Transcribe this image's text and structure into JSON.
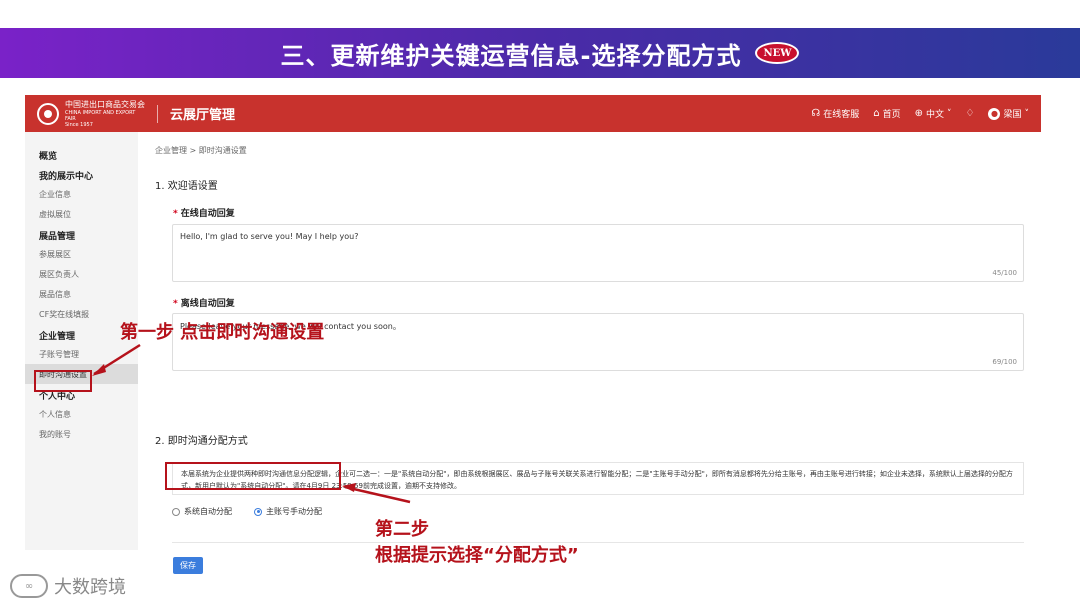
{
  "slide": {
    "title": "三、更新维护关键运营信息-选择分配方式",
    "badge": "NEW"
  },
  "header": {
    "logo_text": "中国进出口商品交易会",
    "logo_sub": "CHINA IMPORT AND EXPORT FAIR",
    "logo_since": "Since 1957",
    "app_name": "云展厅管理",
    "service": "在线客服",
    "home": "首页",
    "language": "中文",
    "user": "梁国"
  },
  "sidebar": {
    "items": [
      {
        "label": "概览",
        "type": "group"
      },
      {
        "label": "我的展示中心",
        "type": "group"
      },
      {
        "label": "企业信息",
        "type": "item"
      },
      {
        "label": "虚拟展位",
        "type": "item"
      },
      {
        "label": "展品管理",
        "type": "group"
      },
      {
        "label": "参展展区",
        "type": "item"
      },
      {
        "label": "展区负责人",
        "type": "item"
      },
      {
        "label": "展品信息",
        "type": "item"
      },
      {
        "label": "CF奖在线填报",
        "type": "item"
      },
      {
        "label": "企业管理",
        "type": "group"
      },
      {
        "label": "子账号管理",
        "type": "item"
      },
      {
        "label": "即时沟通设置",
        "type": "item",
        "active": true
      },
      {
        "label": "个人中心",
        "type": "group"
      },
      {
        "label": "个人信息",
        "type": "item"
      },
      {
        "label": "我的账号",
        "type": "item"
      }
    ]
  },
  "main": {
    "breadcrumb": "企业管理 > 即时沟通设置",
    "section1_title": "1. 欢迎语设置",
    "online_label": "在线自动回复",
    "online_value": "Hello, I'm glad to serve you! May I help you?",
    "online_count": "45/100",
    "offline_label": "离线自动回复",
    "offline_value": "Please leave your message, we will contact you soon。",
    "offline_count": "69/100",
    "section2_title": "2. 即时沟通分配方式",
    "notice": "本届系统为企业提供两种即时沟通信息分配逻辑，企业可二选一：一是\"系统自动分配\"，即由系统根据展区、展品与子账号关联关系进行智能分配；二是\"主账号手动分配\"，即所有消息都将先分给主账号，再由主账号进行转接；如企业未选择，系统默认上届选择的分配方式，新用户默认为\"系统自动分配\"。请在4月9日 23:59:59前完成设置，逾期不支持修改。",
    "radio_auto": "系统自动分配",
    "radio_manual": "主账号手动分配",
    "selected": "manual",
    "save": "保存"
  },
  "annotations": {
    "step1": "第一步   点击即时沟通设置",
    "step2_line1": "第二步",
    "step2_line2": "根据提示选择“分配方式”"
  },
  "watermark": {
    "text": "大数跨境"
  },
  "colors": {
    "header_red": "#c8322d",
    "annotation_red": "#b5121b",
    "primary_blue": "#3b7ddd",
    "title_gradient_start": "#7a22c8",
    "title_gradient_end": "#2a3a9a"
  }
}
